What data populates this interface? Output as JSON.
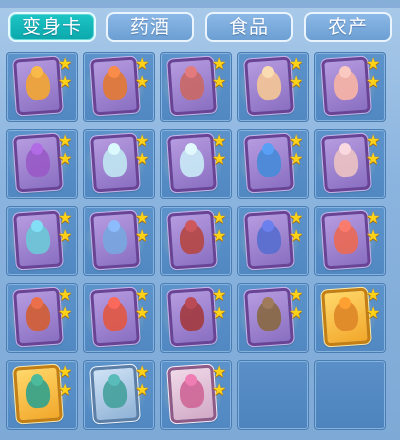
{
  "tabs": [
    {
      "label": "变身卡",
      "active": true
    },
    {
      "label": "药酒",
      "active": false
    },
    {
      "label": "食品",
      "active": false
    },
    {
      "label": "农产",
      "active": false
    }
  ],
  "star_glyph": "★",
  "colors": {
    "active_tab": "#0aa7ab",
    "tab": "#6c9fd3",
    "slot": "#5188c2",
    "star": "#ffd21a"
  },
  "inventory": [
    {
      "type": "card",
      "frame": "purple",
      "char": "#f0a43a",
      "stars": 2
    },
    {
      "type": "card",
      "frame": "purple",
      "char": "#e07a3a",
      "stars": 2
    },
    {
      "type": "card",
      "frame": "purple",
      "char": "#c86a6a",
      "stars": 2
    },
    {
      "type": "card",
      "frame": "purple",
      "char": "#f2c49a",
      "stars": 2
    },
    {
      "type": "card",
      "frame": "purple",
      "char": "#f5b3a8",
      "stars": 2
    },
    {
      "type": "card",
      "frame": "purple",
      "char": "#9a5cc8",
      "stars": 2
    },
    {
      "type": "card",
      "frame": "purple",
      "char": "#bfe3f0",
      "stars": 2
    },
    {
      "type": "card",
      "frame": "purple",
      "char": "#c7e6f5",
      "stars": 2
    },
    {
      "type": "card",
      "frame": "purple",
      "char": "#4a8bd8",
      "stars": 2
    },
    {
      "type": "card",
      "frame": "purple",
      "char": "#e9c0c4",
      "stars": 2
    },
    {
      "type": "card",
      "frame": "purple",
      "char": "#6fc6d8",
      "stars": 2
    },
    {
      "type": "card",
      "frame": "purple",
      "char": "#7aa6e0",
      "stars": 2
    },
    {
      "type": "card",
      "frame": "purple",
      "char": "#b44a4a",
      "stars": 2
    },
    {
      "type": "card",
      "frame": "purple",
      "char": "#5a6fd0",
      "stars": 2
    },
    {
      "type": "card",
      "frame": "purple",
      "char": "#e86b5a",
      "stars": 2
    },
    {
      "type": "card",
      "frame": "purple",
      "char": "#d0603a",
      "stars": 2
    },
    {
      "type": "card",
      "frame": "purple",
      "char": "#e05a4a",
      "stars": 2
    },
    {
      "type": "card",
      "frame": "purple",
      "char": "#a33e46",
      "stars": 2
    },
    {
      "type": "card",
      "frame": "purple",
      "char": "#8a6a4a",
      "stars": 2
    },
    {
      "type": "card",
      "frame": "gold",
      "char": "#e08a2a",
      "stars": 2
    },
    {
      "type": "card",
      "frame": "gold",
      "char": "#3aa38a",
      "stars": 2
    },
    {
      "type": "card",
      "frame": "silver",
      "char": "#4aa3a0",
      "stars": 2
    },
    {
      "type": "card",
      "frame": "pink",
      "char": "#d06a9a",
      "stars": 2
    },
    {
      "type": "empty"
    },
    {
      "type": "empty"
    }
  ]
}
